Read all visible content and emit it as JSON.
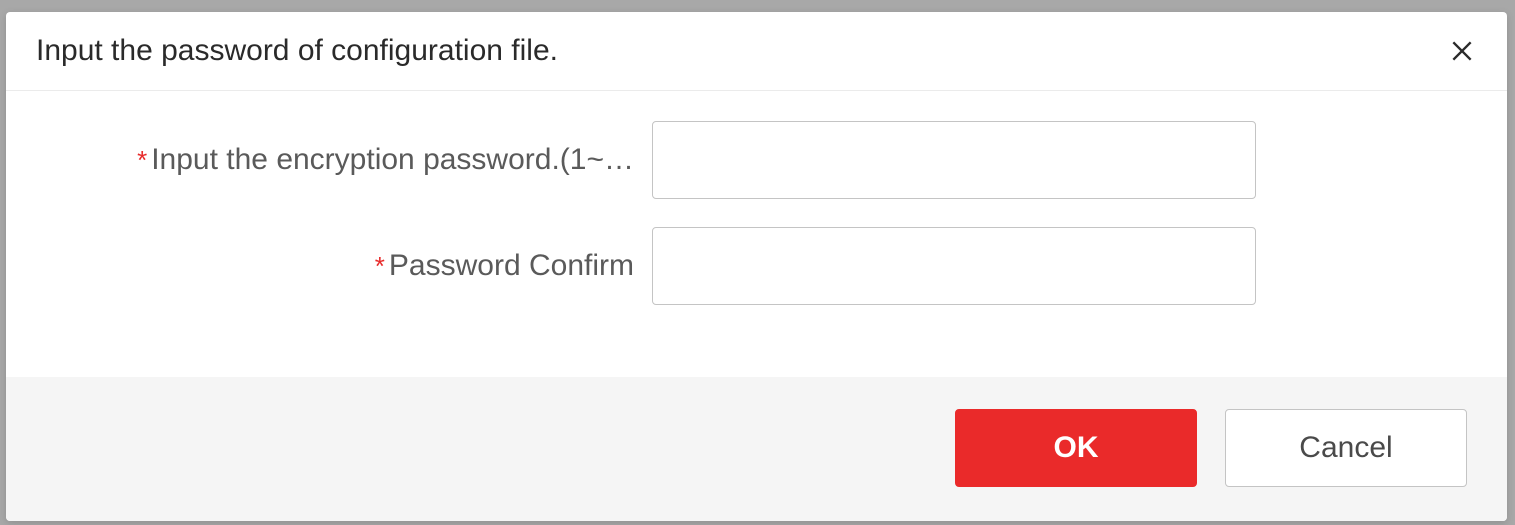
{
  "dialog": {
    "title": "Input the password of configuration file.",
    "fields": {
      "password": {
        "label": "Input the encryption password.(1~…",
        "value": ""
      },
      "confirm": {
        "label": "Password Confirm",
        "value": ""
      }
    },
    "buttons": {
      "ok": "OK",
      "cancel": "Cancel"
    },
    "required_mark": "*"
  },
  "colors": {
    "primary": "#ea2a2a",
    "required": "#e82b2b",
    "border": "#c4c4c4",
    "footer_bg": "#f5f5f5"
  }
}
